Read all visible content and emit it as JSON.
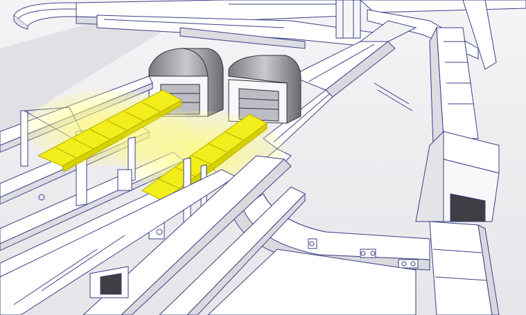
{
  "colors": {
    "background": "#ececef",
    "line": "#3a3f86",
    "surface": "#ffffff",
    "shade": "#d9d9de",
    "dark": "#4a4a4f",
    "highlight": "#f2ee1b"
  },
  "components": [
    "curved-conveyor-top-left",
    "screening-machine-1",
    "screening-machine-2",
    "highlighted-belt-section-1",
    "highlighted-belt-section-2",
    "curved-conveyor-center",
    "long-conveyor-right",
    "vertical-conveyor-far-right",
    "tunnel-unit-right",
    "lower-conveyor-lanes"
  ]
}
